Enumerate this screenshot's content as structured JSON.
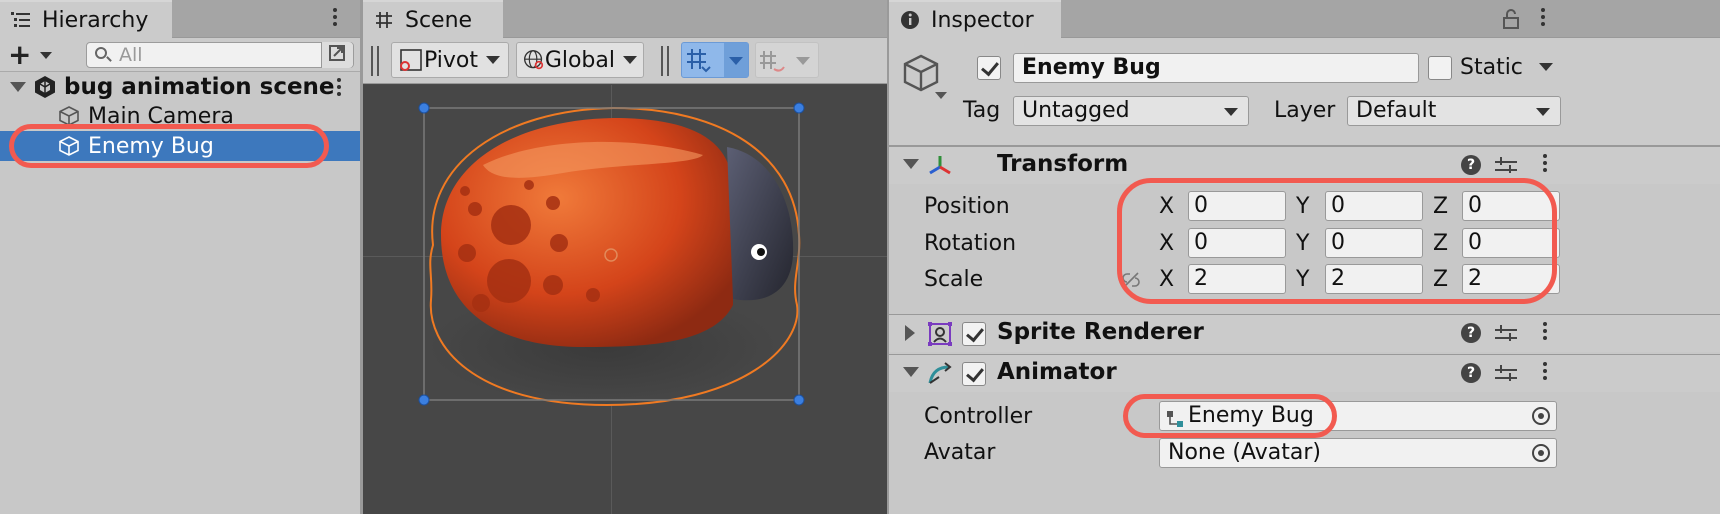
{
  "hierarchy": {
    "tab_label": "Hierarchy",
    "search_placeholder": "All",
    "scene_name": "bug animation scene",
    "items": [
      {
        "label": "Main Camera"
      },
      {
        "label": "Enemy Bug"
      }
    ]
  },
  "scene": {
    "tab_label": "Scene",
    "pivot_label": "Pivot",
    "global_label": "Global"
  },
  "inspector": {
    "tab_label": "Inspector",
    "object_name": "Enemy Bug",
    "static_label": "Static",
    "tag_label": "Tag",
    "tag_value": "Untagged",
    "layer_label": "Layer",
    "layer_value": "Default",
    "transform": {
      "title": "Transform",
      "position_label": "Position",
      "rotation_label": "Rotation",
      "scale_label": "Scale",
      "x": "X",
      "y": "Y",
      "z": "Z",
      "position": [
        "0",
        "0",
        "0"
      ],
      "rotation": [
        "0",
        "0",
        "0"
      ],
      "scale": [
        "2",
        "2",
        "2"
      ]
    },
    "sprite_renderer": {
      "title": "Sprite Renderer"
    },
    "animator": {
      "title": "Animator",
      "controller_label": "Controller",
      "controller_value": "Enemy Bug",
      "avatar_label": "Avatar",
      "avatar_value": "None (Avatar)"
    },
    "help_glyph": "?"
  },
  "colors": {
    "selection": "#3d78bd",
    "highlight_oval": "#f25a50",
    "bug_body": "#d84a14",
    "scene_bg": "#474747"
  },
  "icons": [
    "hierarchy-list-icon",
    "unity-scene-icon",
    "gameobject-cube-icon",
    "grid-icon",
    "inspector-info-icon",
    "lock-icon",
    "transform-axes-icon",
    "sprite-renderer-icon",
    "animator-icon"
  ]
}
